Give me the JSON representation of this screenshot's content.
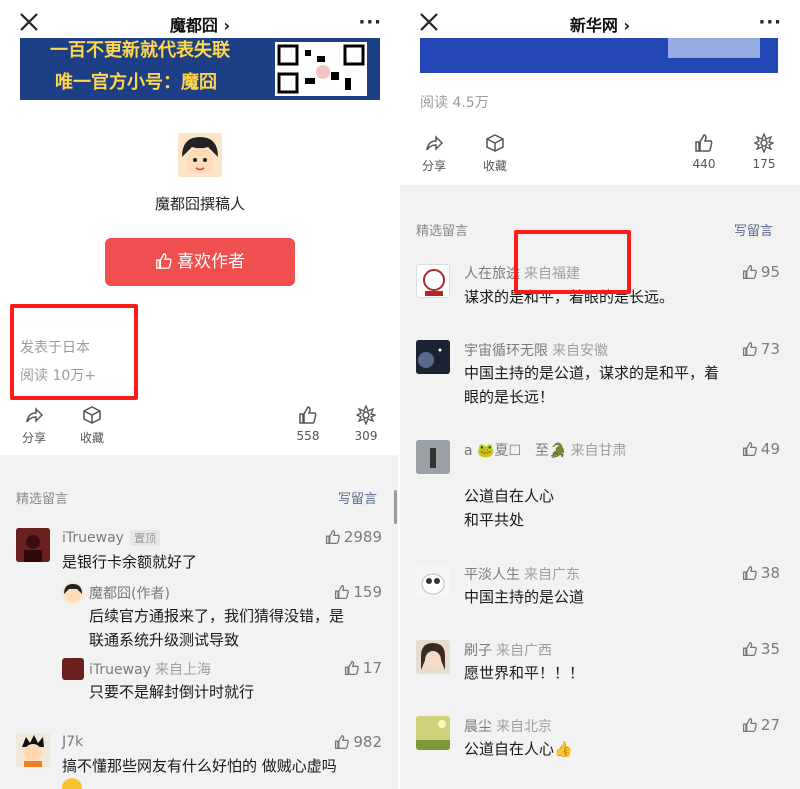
{
  "left": {
    "header": {
      "title": "魔都囧",
      "chevron": "›",
      "more": "···"
    },
    "banner": {
      "line1": "一百不更新就代表失联",
      "line2": "唯一官方小号：魔囧"
    },
    "author": {
      "name": "魔都囧撰稿人"
    },
    "like_button": {
      "label": "喜欢作者"
    },
    "meta": {
      "location": "发表于日本",
      "reads": "阅读 10万+"
    },
    "actions": {
      "share": "分享",
      "collect": "收藏",
      "like_count": "558",
      "wow_count": "309"
    },
    "comments": {
      "section_title": "精选留言",
      "write_label": "写留言",
      "items": [
        {
          "name": "iTrueway",
          "tag": "置顶",
          "likes": "2989",
          "text": "是银行卡余额就好了"
        },
        {
          "name": "魔都囧(作者)",
          "likes": "159",
          "text1": "后续官方通报来了，我们猜得没错，是",
          "text2": "联通系统升级测试导致"
        },
        {
          "name": "iTrueway",
          "from": "来自上海",
          "likes": "17",
          "text": "只要不是解封倒计时就行"
        },
        {
          "name": "J7k",
          "likes": "982",
          "text": "搞不懂那些网友有什么好怕的 做贼心虚吗"
        }
      ]
    }
  },
  "right": {
    "header": {
      "title": "新华网",
      "chevron": "›",
      "more": "···"
    },
    "meta": {
      "reads": "阅读 4.5万"
    },
    "actions": {
      "share": "分享",
      "collect": "收藏",
      "like_count": "440",
      "wow_count": "175"
    },
    "comments": {
      "section_title": "精选留言",
      "write_label": "写留言",
      "items": [
        {
          "name": "人在旅途",
          "from": "来自福建",
          "likes": "95",
          "text": "谋求的是和平，着眼的是长远。"
        },
        {
          "name": "宇宙循环无限",
          "from": "来自安徽",
          "likes": "73",
          "text1": "中国主持的是公道，谋求的是和平，着",
          "text2": "眼的是长远！"
        },
        {
          "name": "a 🐸夏☐　至🐊",
          "from": "来自甘肃",
          "likes": "49",
          "text1": "公道自在人心",
          "text2": "和平共处"
        },
        {
          "name": "平淡人生",
          "from": "来自广东",
          "likes": "38",
          "text": "中国主持的是公道"
        },
        {
          "name": "刷子",
          "from": "来自广西",
          "likes": "35",
          "text": "愿世界和平！！！"
        },
        {
          "name": "晨尘",
          "from": "来自北京",
          "likes": "27",
          "text": "公道自在人心👍"
        }
      ]
    }
  },
  "colors": {
    "like_button": "#f04f4f",
    "highlight": "#ff1a1a",
    "comment_bg": "#f2f2f2"
  },
  "icons": [
    "close-icon",
    "more-icon",
    "share-icon",
    "collect-icon",
    "thumb-up-icon",
    "wow-icon"
  ]
}
